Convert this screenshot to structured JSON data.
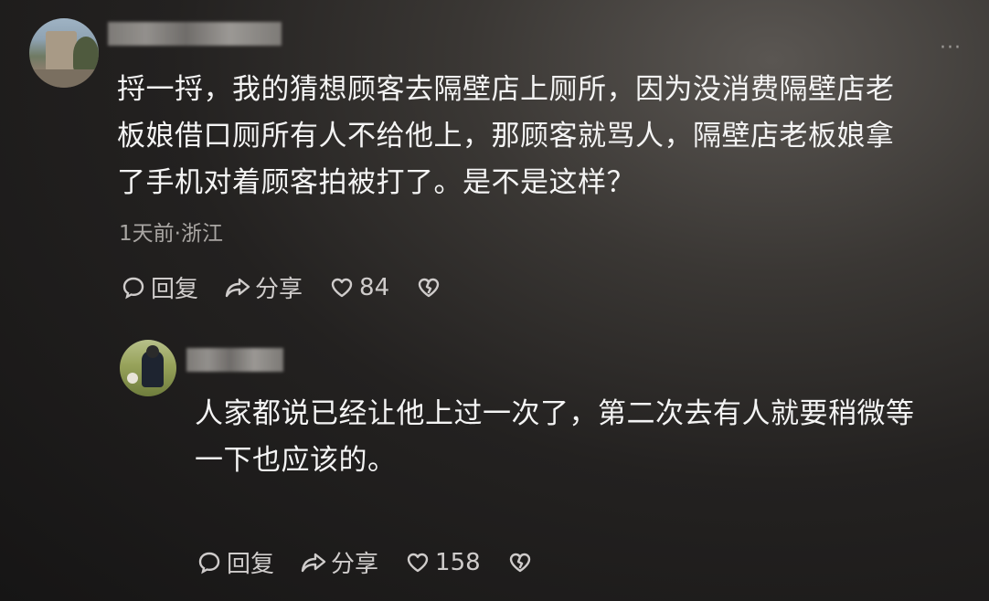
{
  "comments": [
    {
      "text_lines": [
        "捋一捋，我的猜想顾客去隔壁店上厕所，因为没消费隔壁店老",
        "板娘借口厕所有人不给他上，那顾客就骂人，隔壁店老板娘拿",
        "了手机对着顾客拍被打了。是不是这样？"
      ],
      "meta": "1天前·浙江",
      "reply_label": "回复",
      "share_label": "分享",
      "like_count": "84"
    },
    {
      "text_lines": [
        "人家都说已经让他上过一次了，第二次去有人就要稍微等",
        "一下也应该的。"
      ],
      "reply_label": "回复",
      "share_label": "分享",
      "like_count": "158"
    }
  ],
  "icons": {
    "more": "more-icon",
    "reply": "comment-bubble-icon",
    "share": "share-arrow-icon",
    "like": "heart-icon",
    "dislike": "broken-heart-icon"
  },
  "colors": {
    "text": "#f4f4f4",
    "meta": "#a9a6a3",
    "action": "#cfcccb"
  }
}
